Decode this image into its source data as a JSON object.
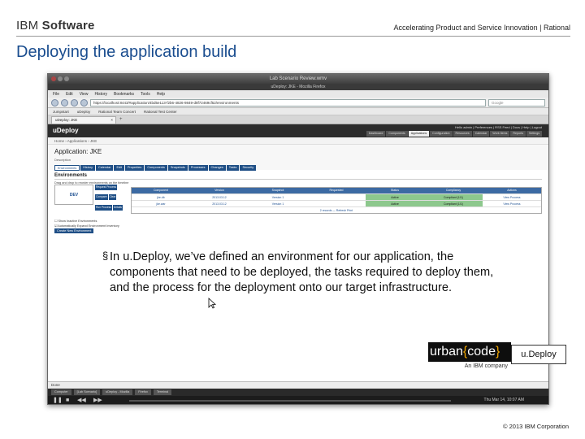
{
  "header": {
    "brand_light": "IBM",
    "brand_bold": "Software",
    "tagline": "Accelerating Product and Service Innovation  |  Rational",
    "title": "Deploying the application build"
  },
  "screenshot": {
    "window_title": "Lab Scenario  Review.wmv",
    "browser_title": "uDeploy: JKE - Mozilla Firefox",
    "menu": [
      "File",
      "Edit",
      "View",
      "History",
      "Bookmarks",
      "Tools",
      "Help"
    ],
    "url": "https://localhost:8443/#application/4bd5e113-f2b6-4826-9849-d8f72469cf52/environments",
    "search_placeholder": "Google",
    "bookmarks": [
      "Jumpstart",
      "uDeploy",
      "Rational Team Concert",
      "Rational Test Center"
    ],
    "tab_label": "uDeploy: JKE",
    "tab_close": "×",
    "tab_new": "+",
    "app_logo": "uDeploy",
    "user_links": "Hello admin | Preferences | RSS Feed | Docs | Help | Logout",
    "top_nav": [
      "Dashboard",
      "Components",
      "Applications",
      "Configuration",
      "Resources",
      "Calendar",
      "Work Items",
      "Reports",
      "Settings"
    ],
    "top_nav_active": "Applications",
    "breadcrumb": "Home › Applications › JKE",
    "app_title": "Application: JKE",
    "description_label": "Description",
    "subtabs": [
      "Environments",
      "History",
      "Calendar",
      "Edit",
      "Properties",
      "Components",
      "Snapshots",
      "Processes",
      "Changes",
      "Tasks",
      "Security"
    ],
    "environments_heading": "Environments",
    "environments_sub": "Drag and drop to reorder environments on the timeline",
    "env_actions": "Actions",
    "env_latest": "Latest Desired Inventory",
    "env_table_headers": [
      "Component",
      "Version",
      "Snapshot",
      "Requested",
      "Status",
      "Compliancy",
      "Actions"
    ],
    "env_name": "DEV",
    "env_buttons": [
      "Request Process",
      "Compare",
      "Clear",
      "Run Process",
      "Details"
    ],
    "env_rows": [
      {
        "component": "jke.db",
        "version": "2013.03.12",
        "snapshot": "Version 1",
        "requested": "",
        "status": "Active",
        "compliancy": "Compliant (1/1)",
        "actions": "View Process"
      },
      {
        "component": "jke.war",
        "version": "2013.03.12",
        "snapshot": "Version 1",
        "requested": "",
        "status": "Active",
        "compliancy": "Compliant (1/1)",
        "actions": "View Process"
      }
    ],
    "env_footer": "2 records  —  Refresh  Print",
    "checks": [
      "Show Inactive Environments",
      "Automatically Expand Environment Inventory"
    ],
    "create_env_button": "Create New Environment",
    "copyright_small": "Powered by uDeploy",
    "taskbar_label": "Done",
    "taskbar_items": [
      "Computer",
      "[Lab Scenario]",
      "uDeploy - Mozilla",
      "Firefox",
      "Terminal"
    ],
    "media_time": "Thu Mar 14, 10:07 AM"
  },
  "callout": {
    "bullet": "§",
    "text": "In u.Deploy, we’ve defined an environment for our application, the components that need to be deployed, the tasks required to deploy them, and the process for the deployment onto our target infrastructure."
  },
  "logo": {
    "urban": "urban",
    "brace_open": "{",
    "code": "code",
    "brace_close": "}",
    "subtitle": "An IBM company",
    "product_label": "u.Deploy"
  },
  "footer": {
    "copyright": "© 2013 IBM Corporation"
  }
}
